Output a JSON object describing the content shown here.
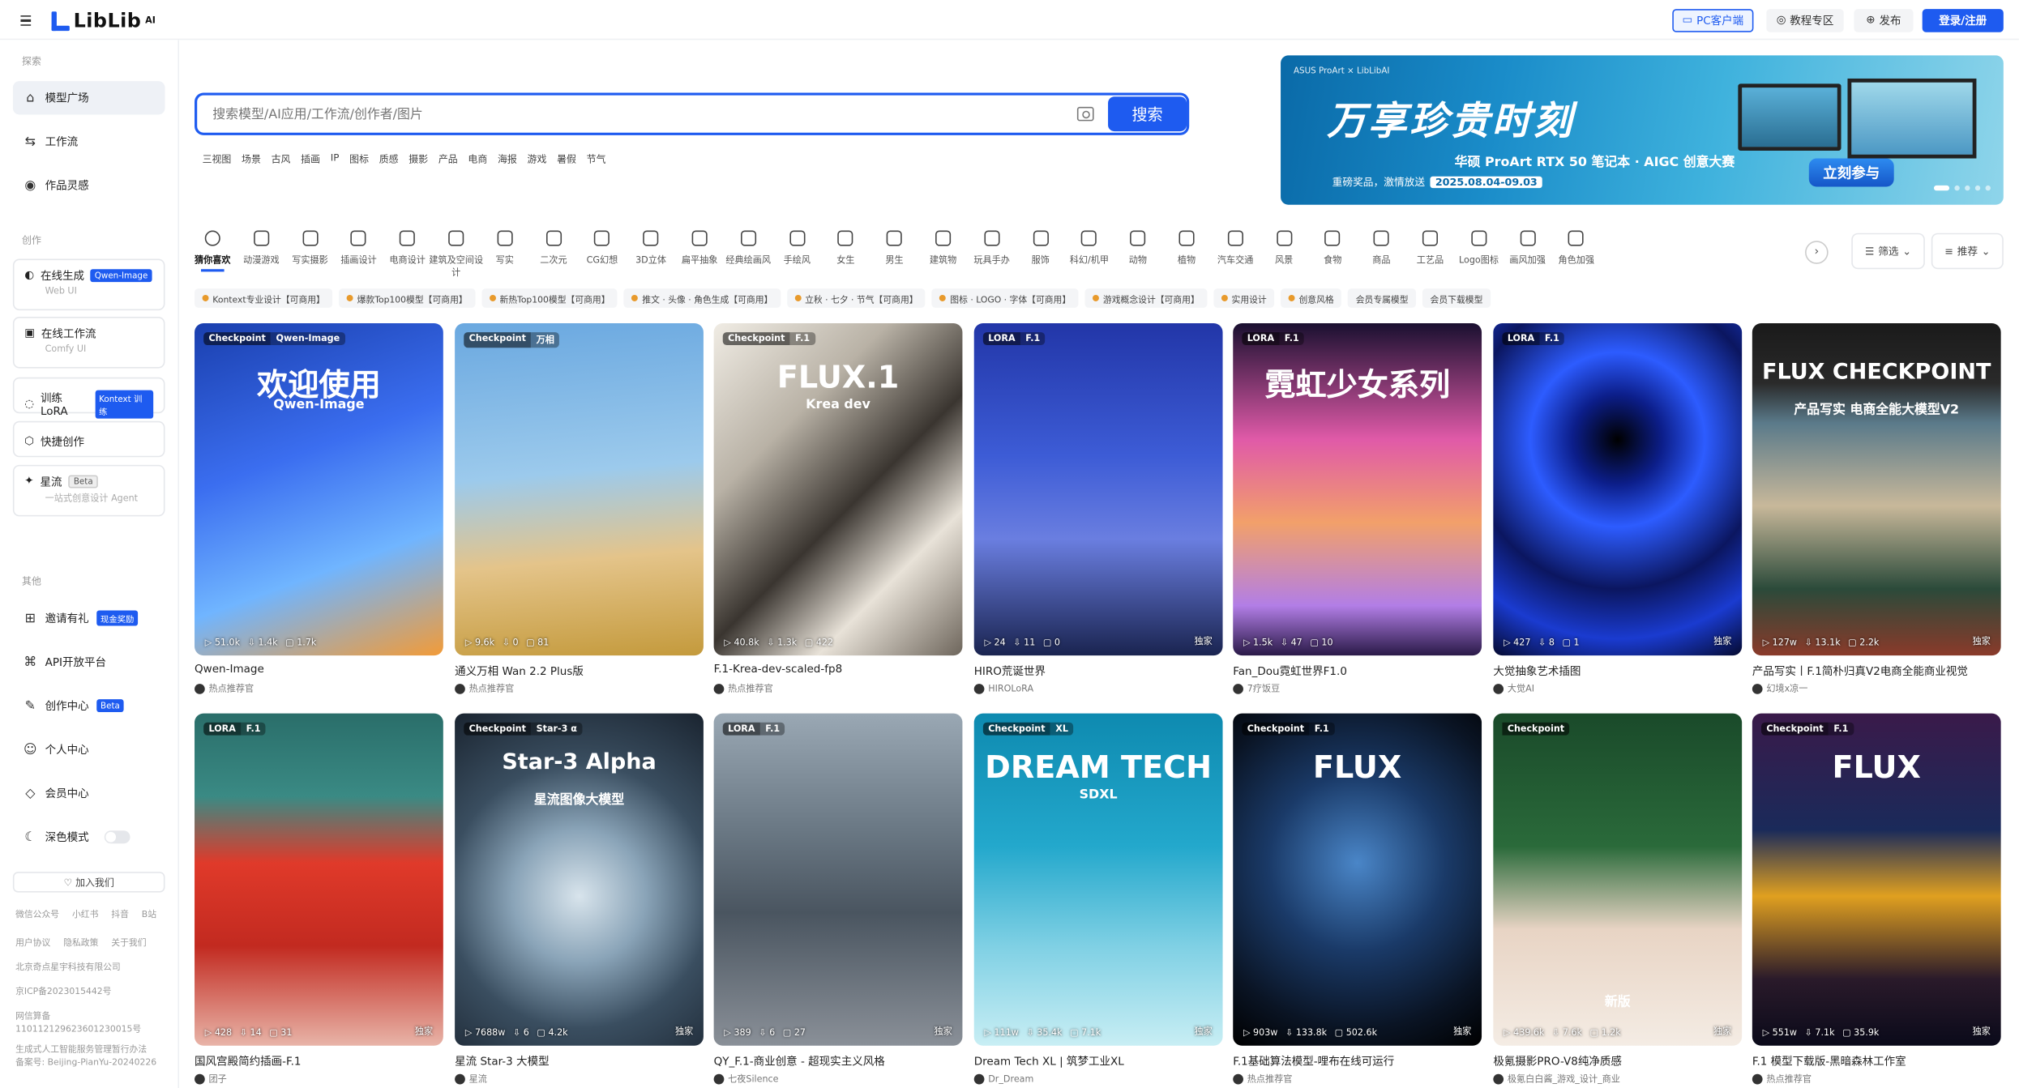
{
  "header": {
    "logo_text": "LibLib",
    "logo_sup": "AI",
    "pc_client": "PC客户端",
    "tutorials": "教程专区",
    "publish": "发布",
    "login": "登录/注册"
  },
  "sidebar": {
    "section_explore": "探索",
    "model_square": "模型广场",
    "workflow": "工作流",
    "inspiration": "作品灵感",
    "section_create": "创作",
    "online_gen": "在线生成",
    "online_gen_tag": "Qwen-Image",
    "online_gen_sub": "Web UI",
    "online_workflow": "在线工作流",
    "online_workflow_sub": "Comfy UI",
    "train_lora": "训练LoRA",
    "train_lora_tag": "Kontext 训练",
    "quick_create": "快捷创作",
    "xingliu": "星流",
    "xingliu_tag": "Beta",
    "xingliu_sub": "一站式创意设计 Agent",
    "section_other": "其他",
    "invite": "邀请有礼",
    "invite_tag": "现金奖励",
    "api": "API开放平台",
    "creator_center": "创作中心",
    "creator_tag": "Beta",
    "personal": "个人中心",
    "member": "会员中心",
    "dark_mode": "深色模式",
    "join_us": "加入我们",
    "social": [
      "微信公众号",
      "小红书",
      "抖音",
      "B站"
    ],
    "links": [
      "用户协议",
      "隐私政策",
      "关于我们"
    ],
    "company": "北京奇点星宇科技有限公司",
    "icp": "京ICP备2023015442号",
    "police_title": "网信算备",
    "police_no": "110112129623601230015号",
    "ai_service": "生成式人工智能服务管理暂行办法",
    "record": "备案号: Beijing-PianYu-20240226"
  },
  "search": {
    "placeholder": "搜索模型/AI应用/工作流/创作者/图片",
    "button": "搜索",
    "hot_keywords": [
      "三视图",
      "场景",
      "古风",
      "插画",
      "IP",
      "图标",
      "质感",
      "摄影",
      "产品",
      "电商",
      "海报",
      "游戏",
      "暑假",
      "节气"
    ]
  },
  "banner": {
    "brand": "ASUS ProArt × LibLibAI",
    "headline": "万享珍贵时刻",
    "sub": "华硕 ProArt RTX 50 笔记本 · AIGC 创意大赛",
    "date_label": "重磅奖品，激情放送",
    "date": "2025.08.04-09.03",
    "cta": "立刻参与"
  },
  "categories": [
    "猜你喜欢",
    "动漫游戏",
    "写实摄影",
    "插画设计",
    "电商设计",
    "建筑及空间设计",
    "写实",
    "二次元",
    "CG幻想",
    "3D立体",
    "扁平抽象",
    "经典绘画风",
    "手绘风",
    "女生",
    "男生",
    "建筑物",
    "玩具手办",
    "服饰",
    "科幻/机甲",
    "动物",
    "植物",
    "汽车交通",
    "风景",
    "食物",
    "商品",
    "工艺品",
    "Logo图标",
    "画风加强",
    "角色加强"
  ],
  "filters": {
    "filter": "筛选",
    "sort": "推荐"
  },
  "chips": [
    "Kontext专业设计【可商用】",
    "爆款Top100模型【可商用】",
    "新热Top100模型【可商用】",
    "推文 · 头像 · 角色生成【可商用】",
    "立秋 · 七夕 · 节气【可商用】",
    "图标 · LOGO · 字体【可商用】",
    "游戏概念设计【可商用】",
    "实用设计",
    "创意风格",
    "会员专属模型",
    "会员下载模型"
  ],
  "cards_row1": [
    {
      "b1": "Checkpoint",
      "b2": "Qwen-Image",
      "overlay": "欢迎使用",
      "overlay2": "Qwen-Image",
      "s1": "51.0k",
      "s2": "1.4k",
      "s3": "1.7k",
      "excl": "",
      "title": "Qwen-Image",
      "author": "热点推荐官",
      "bg": "linear-gradient(160deg,#1a3fae 0%,#3b6ef0 40%,#70b5ff 70%,#f29b38 100%)"
    },
    {
      "b1": "Checkpoint",
      "b2": "万相",
      "overlay": "",
      "overlay2": "",
      "s1": "9.6k",
      "s2": "0",
      "s3": "81",
      "excl": "",
      "title": "通义万相 Wan 2.2 Plus版",
      "author": "热点推荐官",
      "bg": "linear-gradient(175deg,#6aa8e0 0%,#9ccaec 45%,#e4c48a 70%,#c49a3c 100%)"
    },
    {
      "b1": "Checkpoint",
      "b2": "F.1",
      "overlay": "FLUX.1",
      "overlay2": "Krea dev",
      "s1": "40.8k",
      "s2": "1.3k",
      "s3": "422",
      "excl": "",
      "title": "F.1-Krea-dev-scaled-fp8",
      "author": "热点推荐官",
      "bg": "linear-gradient(135deg,#f0ece4 0%,#b9b2a6 30%,#3a3530 55%,#e8e2d8 75%,#6e665c 100%)"
    },
    {
      "b1": "LORA",
      "b2": "F.1",
      "overlay": "",
      "overlay2": "",
      "s1": "24",
      "s2": "11",
      "s3": "0",
      "excl": "独家",
      "title": "HIRO荒诞世界",
      "author": "HIROLoRA",
      "bg": "linear-gradient(180deg,#2236a8 0%,#3d5cd6 40%,#6a7ee0 65%,#1a2450 100%)"
    },
    {
      "b1": "LORA",
      "b2": "F.1",
      "overlay": "霓虹少女系列",
      "overlay2": "",
      "s1": "1.5k",
      "s2": "47",
      "s3": "10",
      "excl": "",
      "title": "Fan_Dou霓虹世界F1.0",
      "author": "7疗饭豆",
      "bg": "linear-gradient(180deg,#1a1030 0%,#e05aa8 35%,#f2a06a 60%,#b27ee6 85%,#2a1a48 100%)"
    },
    {
      "b1": "LORA",
      "b2": "F.1",
      "overlay": "",
      "overlay2": "",
      "s1": "427",
      "s2": "8",
      "s3": "1",
      "excl": "独家",
      "title": "大觉抽象艺术插图",
      "author": "大觉AI",
      "bg": "radial-gradient(circle at 50% 35%,#000 0%,#0c1e8a 18%,#2d5cff 35%,#0b1660 60%,#1a3bd0 80%,#050a30 100%)"
    },
    {
      "b1": "",
      "b2": "",
      "overlay": "FLUX CHECKPOINT",
      "overlay2": "产品写实 电商全能大模型V2",
      "s1": "127w",
      "s2": "13.1k",
      "s3": "2.2k",
      "excl": "独家",
      "title": "产品写实丨F.1简朴归真V2电商全能商业视觉",
      "author": "幻境x凉一",
      "bg": "linear-gradient(180deg,#1a1a1a 0%,#2a2a2a 18%,#5a7a8a 30%,#c8b89a 55%,#2b4a3a 80%,#8a3a2a 100%)"
    }
  ],
  "cards_row2": [
    {
      "b1": "LORA",
      "b2": "F.1",
      "overlay": "",
      "overlay2": "",
      "s1": "428",
      "s2": "14",
      "s3": "31",
      "excl": "独家",
      "title": "国风宫殿简约插画-F.1",
      "author": "团子",
      "bg": "linear-gradient(180deg,#2a6e6a 0%,#3a8a84 25%,#e03a2a 45%,#c22a20 70%,#e8b4a8 100%)"
    },
    {
      "b1": "Checkpoint",
      "b2": "Star-3 α",
      "overlay": "Star-3 Alpha",
      "overlay2": "星流图像大模型",
      "s1": "7688w",
      "s2": "6",
      "s3": "4.2k",
      "excl": "独家",
      "title": "星流 Star-3 大模型",
      "author": "星流",
      "bg": "radial-gradient(circle at 50% 55%,#d8e4ec 0%,#8aa4b8 30%,#3a4e60 60%,#1a2430 100%)"
    },
    {
      "b1": "LORA",
      "b2": "F.1",
      "overlay": "",
      "overlay2": "",
      "s1": "389",
      "s2": "6",
      "s3": "27",
      "excl": "独家",
      "title": "QY_F.1-商业创意 - 超现实主义风格",
      "author": "七夜Silence",
      "bg": "linear-gradient(180deg,#9aa8b4 0%,#6a7884 35%,#4a5560 60%,#8a9098 100%)"
    },
    {
      "b1": "Checkpoint",
      "b2": "XL",
      "overlay": "DREAM TECH",
      "overlay2": "SDXL",
      "s1": "111w",
      "s2": "35.4k",
      "s3": "7.1k",
      "excl": "独家",
      "title": "Dream Tech XL | 筑梦工业XL",
      "author": "Dr_Dream",
      "bg": "linear-gradient(180deg,#0e8ab0 0%,#23a8cc 40%,#7fd0e4 70%,#c8eef4 100%)"
    },
    {
      "b1": "Checkpoint",
      "b2": "F.1",
      "overlay": "FLUX",
      "overlay2": "",
      "s1": "903w",
      "s2": "133.8k",
      "s3": "502.6k",
      "excl": "独家",
      "title": "F.1基础算法模型-哩布在线可运行",
      "author": "热点推荐官",
      "bg": "radial-gradient(circle at 50% 45%,#4a86c8 0%,#1a3a68 40%,#0a1424 75%,#000 100%)"
    },
    {
      "b1": "Checkpoint",
      "b2": "",
      "overlay": "",
      "overlay2": "新版",
      "s1": "439.6k",
      "s2": "7.6k",
      "s3": "1.2k",
      "excl": "独家",
      "title": "极氪摄影PRO-V8纯净质感",
      "author": "极氪白白酱_游戏_设计_商业",
      "bg": "linear-gradient(180deg,#1a4a2a 0%,#2a6a3a 40%,#e8d4c4 65%,#f4ece4 100%)"
    },
    {
      "b1": "Checkpoint",
      "b2": "F.1",
      "overlay": "FLUX",
      "overlay2": "",
      "s1": "551w",
      "s2": "7.1k",
      "s3": "35.9k",
      "excl": "独家",
      "title": "F.1 模型下载版-黑暗森林工作室",
      "author": "热点推荐官",
      "bg": "linear-gradient(180deg,#3a1a4a 0%,#1a2a5a 35%,#e0a020 55%,#2a1a2a 80%,#0a0a1a 100%)"
    }
  ]
}
